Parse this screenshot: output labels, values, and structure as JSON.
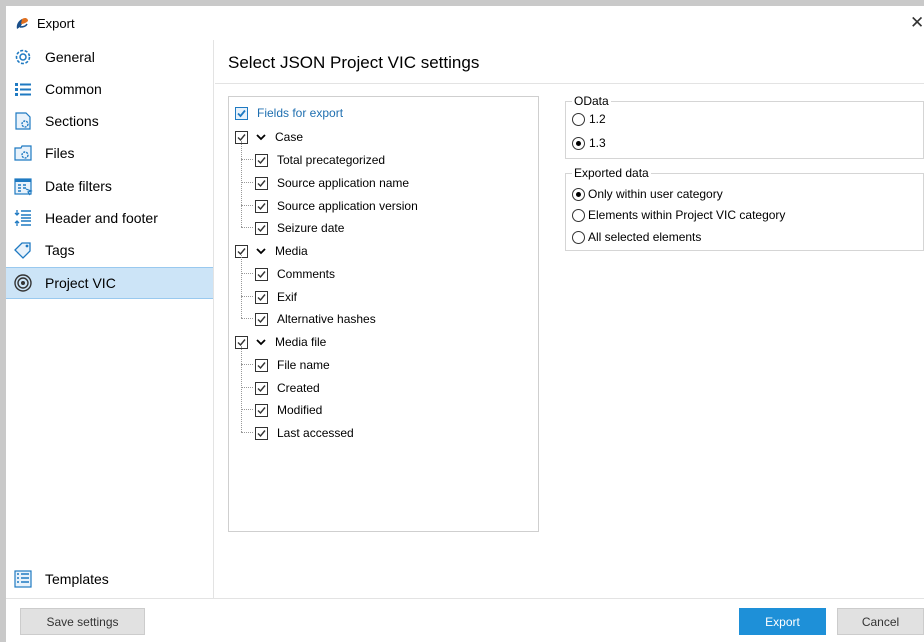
{
  "window": {
    "title": "Export",
    "close_glyph": "✕"
  },
  "sidebar": {
    "items": [
      {
        "label": "General",
        "icon": "gear-icon"
      },
      {
        "label": "Common",
        "icon": "list-icon"
      },
      {
        "label": "Sections",
        "icon": "sections-icon"
      },
      {
        "label": "Files",
        "icon": "files-icon"
      },
      {
        "label": "Date filters",
        "icon": "calendar-icon"
      },
      {
        "label": "Header and footer",
        "icon": "header-footer-icon"
      },
      {
        "label": "Tags",
        "icon": "tags-icon"
      },
      {
        "label": "Project VIC",
        "icon": "project-vic-icon"
      }
    ],
    "active_index": 7,
    "templates_label": "Templates"
  },
  "main": {
    "title": "Select JSON Project VIC settings",
    "tree": {
      "root_label": "Fields for export",
      "groups": [
        {
          "label": "Case",
          "children": [
            "Total precategorized",
            "Source application name",
            "Source application version",
            "Seizure date"
          ]
        },
        {
          "label": "Media",
          "children": [
            "Comments",
            "Exif",
            "Alternative hashes"
          ]
        },
        {
          "label": "Media file",
          "children": [
            "File name",
            "Created",
            "Modified",
            "Last accessed"
          ]
        }
      ]
    },
    "odata": {
      "title": "OData",
      "options": [
        "1.2",
        "1.3"
      ],
      "selected": "1.3"
    },
    "exported_data": {
      "title": "Exported data",
      "options": [
        "Only within user category",
        "Elements within Project VIC category",
        "All selected elements"
      ],
      "selected": "Only within user category"
    }
  },
  "footer": {
    "save_settings": "Save settings",
    "export": "Export",
    "cancel": "Cancel"
  },
  "colors": {
    "accent": "#1e90d8",
    "selection": "#cce4f7"
  }
}
